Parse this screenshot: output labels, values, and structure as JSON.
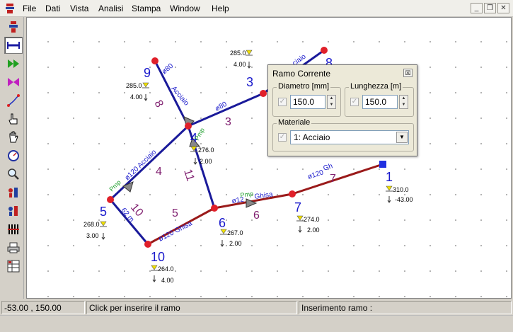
{
  "menu": [
    "File",
    "Dati",
    "Vista",
    "Analisi",
    "Stampa",
    "Window",
    "Help"
  ],
  "window_controls": [
    "_",
    "❒",
    "✕"
  ],
  "toolbar": [
    "select-node-tool",
    "pipe-tool",
    "play-tool",
    "valve-tool",
    "line-tool",
    "hand-tool",
    "hand-tool-2",
    "gauge-tool",
    "zoom-tool",
    "color-tool-1",
    "color-tool-2",
    "bars-tool",
    "print-tool",
    "table-tool"
  ],
  "network": {
    "node_labels": [
      "9",
      "3",
      "8",
      "4",
      "5",
      "6",
      "7",
      "1",
      "10"
    ],
    "branch_labels": [
      "8",
      "3",
      "4",
      "11",
      "5",
      "10",
      "6",
      "7"
    ],
    "pipe_texts": [
      "ø80",
      "Acciaio",
      "ø80",
      "ø120 Acciaio",
      "ø120 Ghisa",
      "ø12",
      "Ghisa",
      "ø120",
      "Gh",
      "62 m",
      "ciaio"
    ],
    "pump_texts": [
      "Pmp",
      "Pmp",
      "Pmp"
    ],
    "node_data": [
      {
        "z": "285.0",
        "d": "4.00"
      },
      {
        "z": "285.0",
        "d": "4.00"
      },
      {
        "z": "276.0",
        "d": "2.00"
      },
      {
        "z": "268.0",
        "d": "3.00"
      },
      {
        "z": "267.0",
        "d": "2.00"
      },
      {
        "z": "274.0",
        "d": "2.00"
      },
      {
        "z": "310.0",
        "d": "-43.00"
      },
      {
        "z": "264.0",
        "d": "4.00"
      }
    ]
  },
  "dialog": {
    "title": "Ramo Corrente",
    "diametro_label": "Diametro [mm]",
    "diametro_value": "150.0",
    "lunghezza_label": "Lunghezza [m]",
    "lunghezza_value": "150.0",
    "materiale_label": "Materiale",
    "materiale_value": "1: Acciaio",
    "close": "☒"
  },
  "status": {
    "coords": "-53.00 , 150.00",
    "hint": "Click per inserire il ramo",
    "mode": "Inserimento ramo :"
  },
  "colors": {
    "node": "#e0202a",
    "pipe_blue": "#1a1a9a",
    "pipe_red": "#9a1a1a",
    "node_label": "#1a1acc",
    "branch_label": "#802070",
    "pump": "#22a030",
    "reservoir": "#f0e000",
    "selected_node": "#2030e0"
  }
}
